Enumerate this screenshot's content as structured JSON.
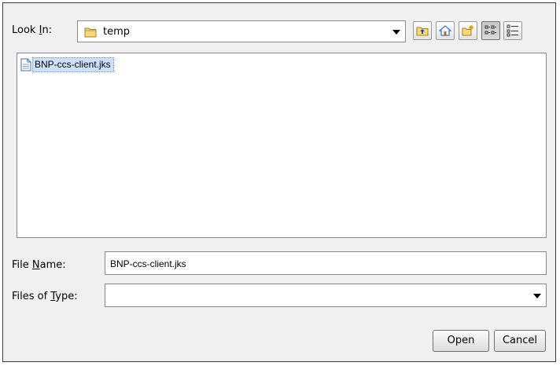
{
  "look_in": {
    "label_pre": "Look ",
    "label_mnemonic": "I",
    "label_post": "n:",
    "value": "temp",
    "folder_icon": "folder-icon"
  },
  "toolbar": {
    "up": "up-one-level-icon",
    "home": "home-icon",
    "new_folder": "new-folder-icon",
    "list_view": "list-view-icon",
    "details_view": "details-view-icon"
  },
  "files": [
    {
      "name": "BNP-ccs-client.jks",
      "icon": "file-icon",
      "selected": true
    }
  ],
  "file_name": {
    "label_pre": "File ",
    "label_mnemonic": "N",
    "label_post": "ame:",
    "value": "BNP-ccs-client.jks"
  },
  "file_type": {
    "label_pre": "Files of ",
    "label_mnemonic": "T",
    "label_post": "ype:",
    "value": ""
  },
  "buttons": {
    "open": "Open",
    "cancel": "Cancel"
  }
}
